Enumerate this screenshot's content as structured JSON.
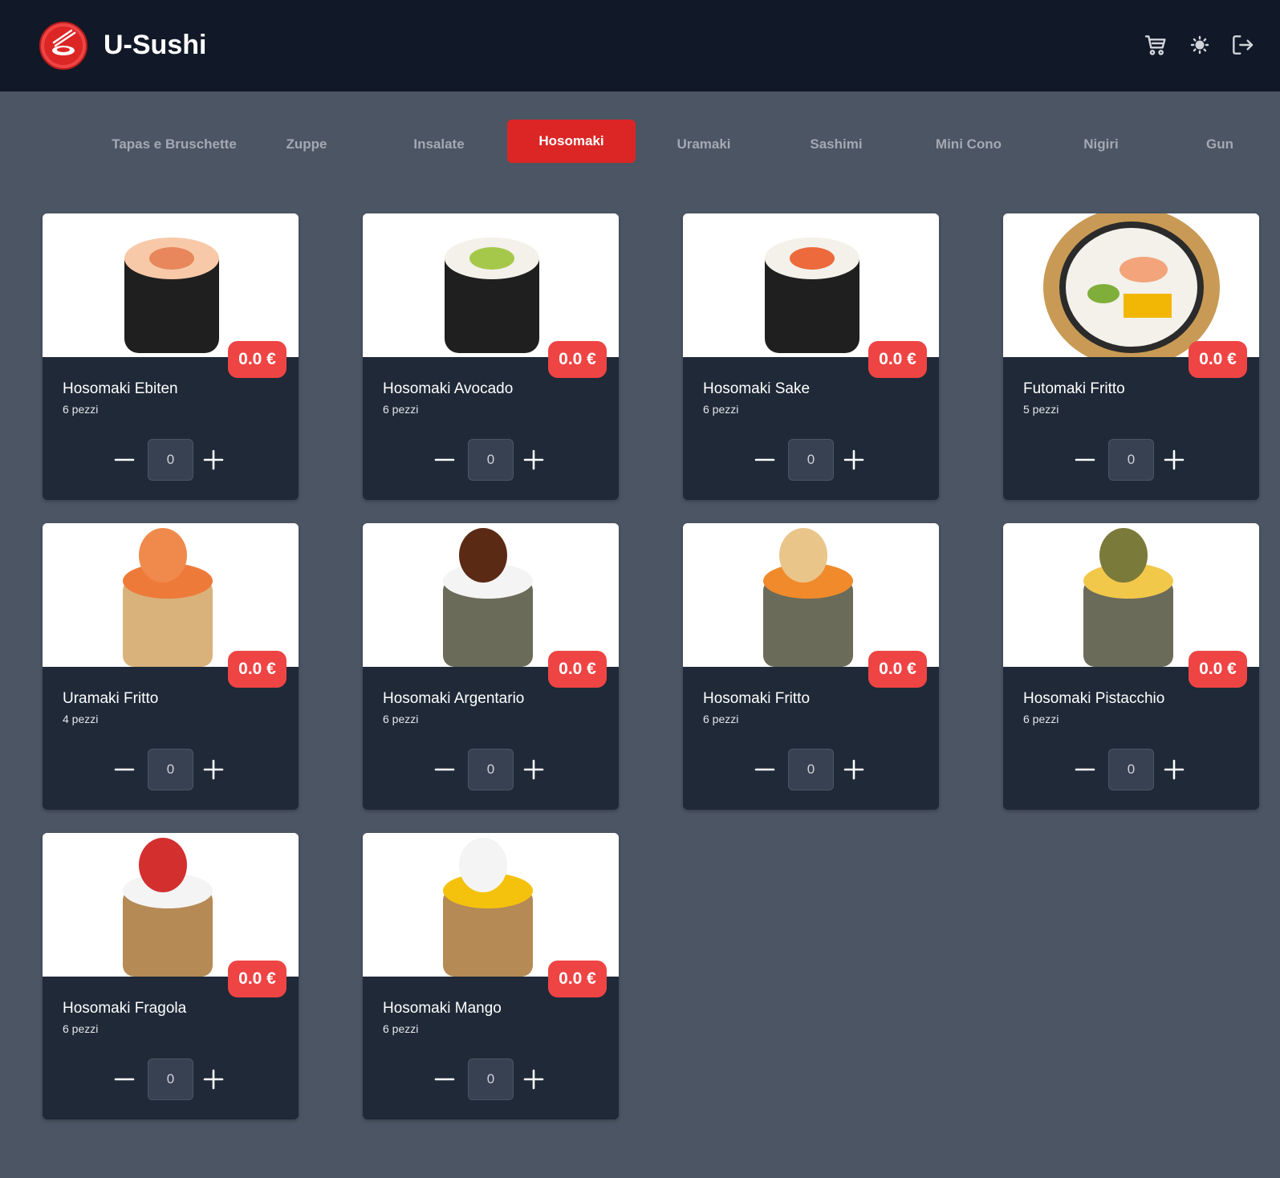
{
  "header": {
    "brand": "U-Sushi",
    "icons": [
      "cart-icon",
      "sun-icon",
      "logout-icon"
    ]
  },
  "tabs": [
    {
      "label": "Tapas e Bruschette",
      "active": false
    },
    {
      "label": "Zuppe",
      "active": false
    },
    {
      "label": "Insalate",
      "active": false
    },
    {
      "label": "Hosomaki",
      "active": true
    },
    {
      "label": "Uramaki",
      "active": false
    },
    {
      "label": "Sashimi",
      "active": false
    },
    {
      "label": "Mini Cono",
      "active": false
    },
    {
      "label": "Nigiri",
      "active": false
    },
    {
      "label": "Gun",
      "active": false
    }
  ],
  "products": [
    {
      "name": "Hosomaki Ebiten",
      "pieces": "6 pezzi",
      "price": "0.0 €",
      "qty": "0"
    },
    {
      "name": "Hosomaki Avocado",
      "pieces": "6 pezzi",
      "price": "0.0 €",
      "qty": "0"
    },
    {
      "name": "Hosomaki Sake",
      "pieces": "6 pezzi",
      "price": "0.0 €",
      "qty": "0"
    },
    {
      "name": "Futomaki Fritto",
      "pieces": "5 pezzi",
      "price": "0.0 €",
      "qty": "0"
    },
    {
      "name": "Uramaki Fritto",
      "pieces": "4 pezzi",
      "price": "0.0 €",
      "qty": "0"
    },
    {
      "name": "Hosomaki Argentario",
      "pieces": "6 pezzi",
      "price": "0.0 €",
      "qty": "0"
    },
    {
      "name": "Hosomaki Fritto",
      "pieces": "6 pezzi",
      "price": "0.0 €",
      "qty": "0"
    },
    {
      "name": "Hosomaki Pistacchio",
      "pieces": "6 pezzi",
      "price": "0.0 €",
      "qty": "0"
    },
    {
      "name": "Hosomaki Fragola",
      "pieces": "6 pezzi",
      "price": "0.0 €",
      "qty": "0"
    },
    {
      "name": "Hosomaki Mango",
      "pieces": "6 pezzi",
      "price": "0.0 €",
      "qty": "0"
    }
  ],
  "colors": {
    "header_bg": "#111827",
    "page_bg": "#4b5563",
    "card_bg": "#1f2937",
    "accent": "#dc2626",
    "price_badge": "#ef4444"
  }
}
